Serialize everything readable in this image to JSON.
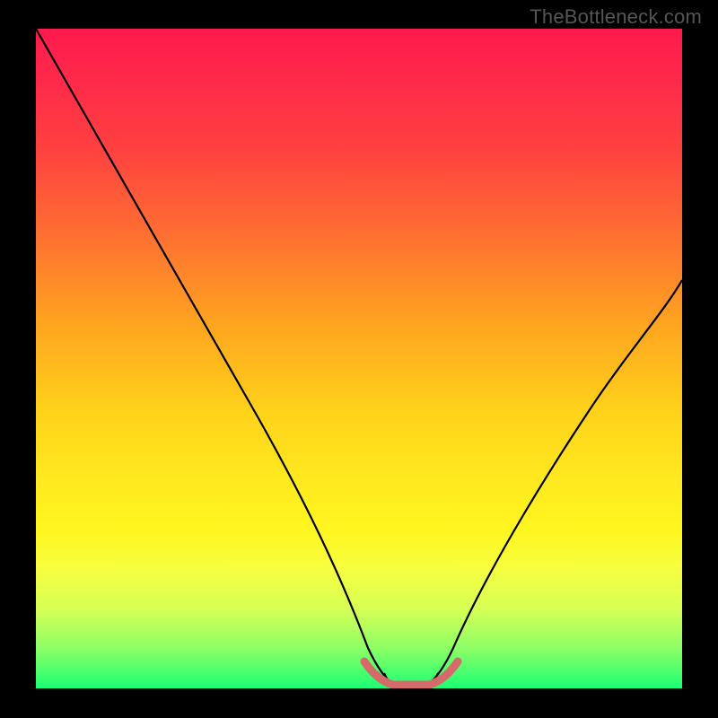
{
  "watermark": "TheBottleneck.com",
  "colors": {
    "background": "#000000",
    "curve_stroke": "#000000",
    "bottom_marker": "#d46a6a",
    "gradient_top": "#ff1a4d",
    "gradient_bottom": "#1aff73"
  },
  "chart_data": {
    "type": "line",
    "title": "",
    "xlabel": "",
    "ylabel": "",
    "xlim": [
      0,
      100
    ],
    "ylim": [
      0,
      100
    ],
    "x": [
      0,
      5,
      10,
      15,
      20,
      25,
      30,
      35,
      40,
      45,
      50,
      52,
      56,
      60,
      62,
      65,
      70,
      75,
      80,
      85,
      90,
      95,
      100
    ],
    "values": [
      100,
      92,
      83,
      74,
      66,
      57,
      48,
      39,
      30,
      20,
      8,
      2,
      0,
      0,
      2,
      8,
      16,
      25,
      33,
      41,
      48,
      55,
      62
    ],
    "bottom_marker_range_x": [
      50,
      62
    ],
    "annotations": [
      "TheBottleneck.com"
    ]
  }
}
